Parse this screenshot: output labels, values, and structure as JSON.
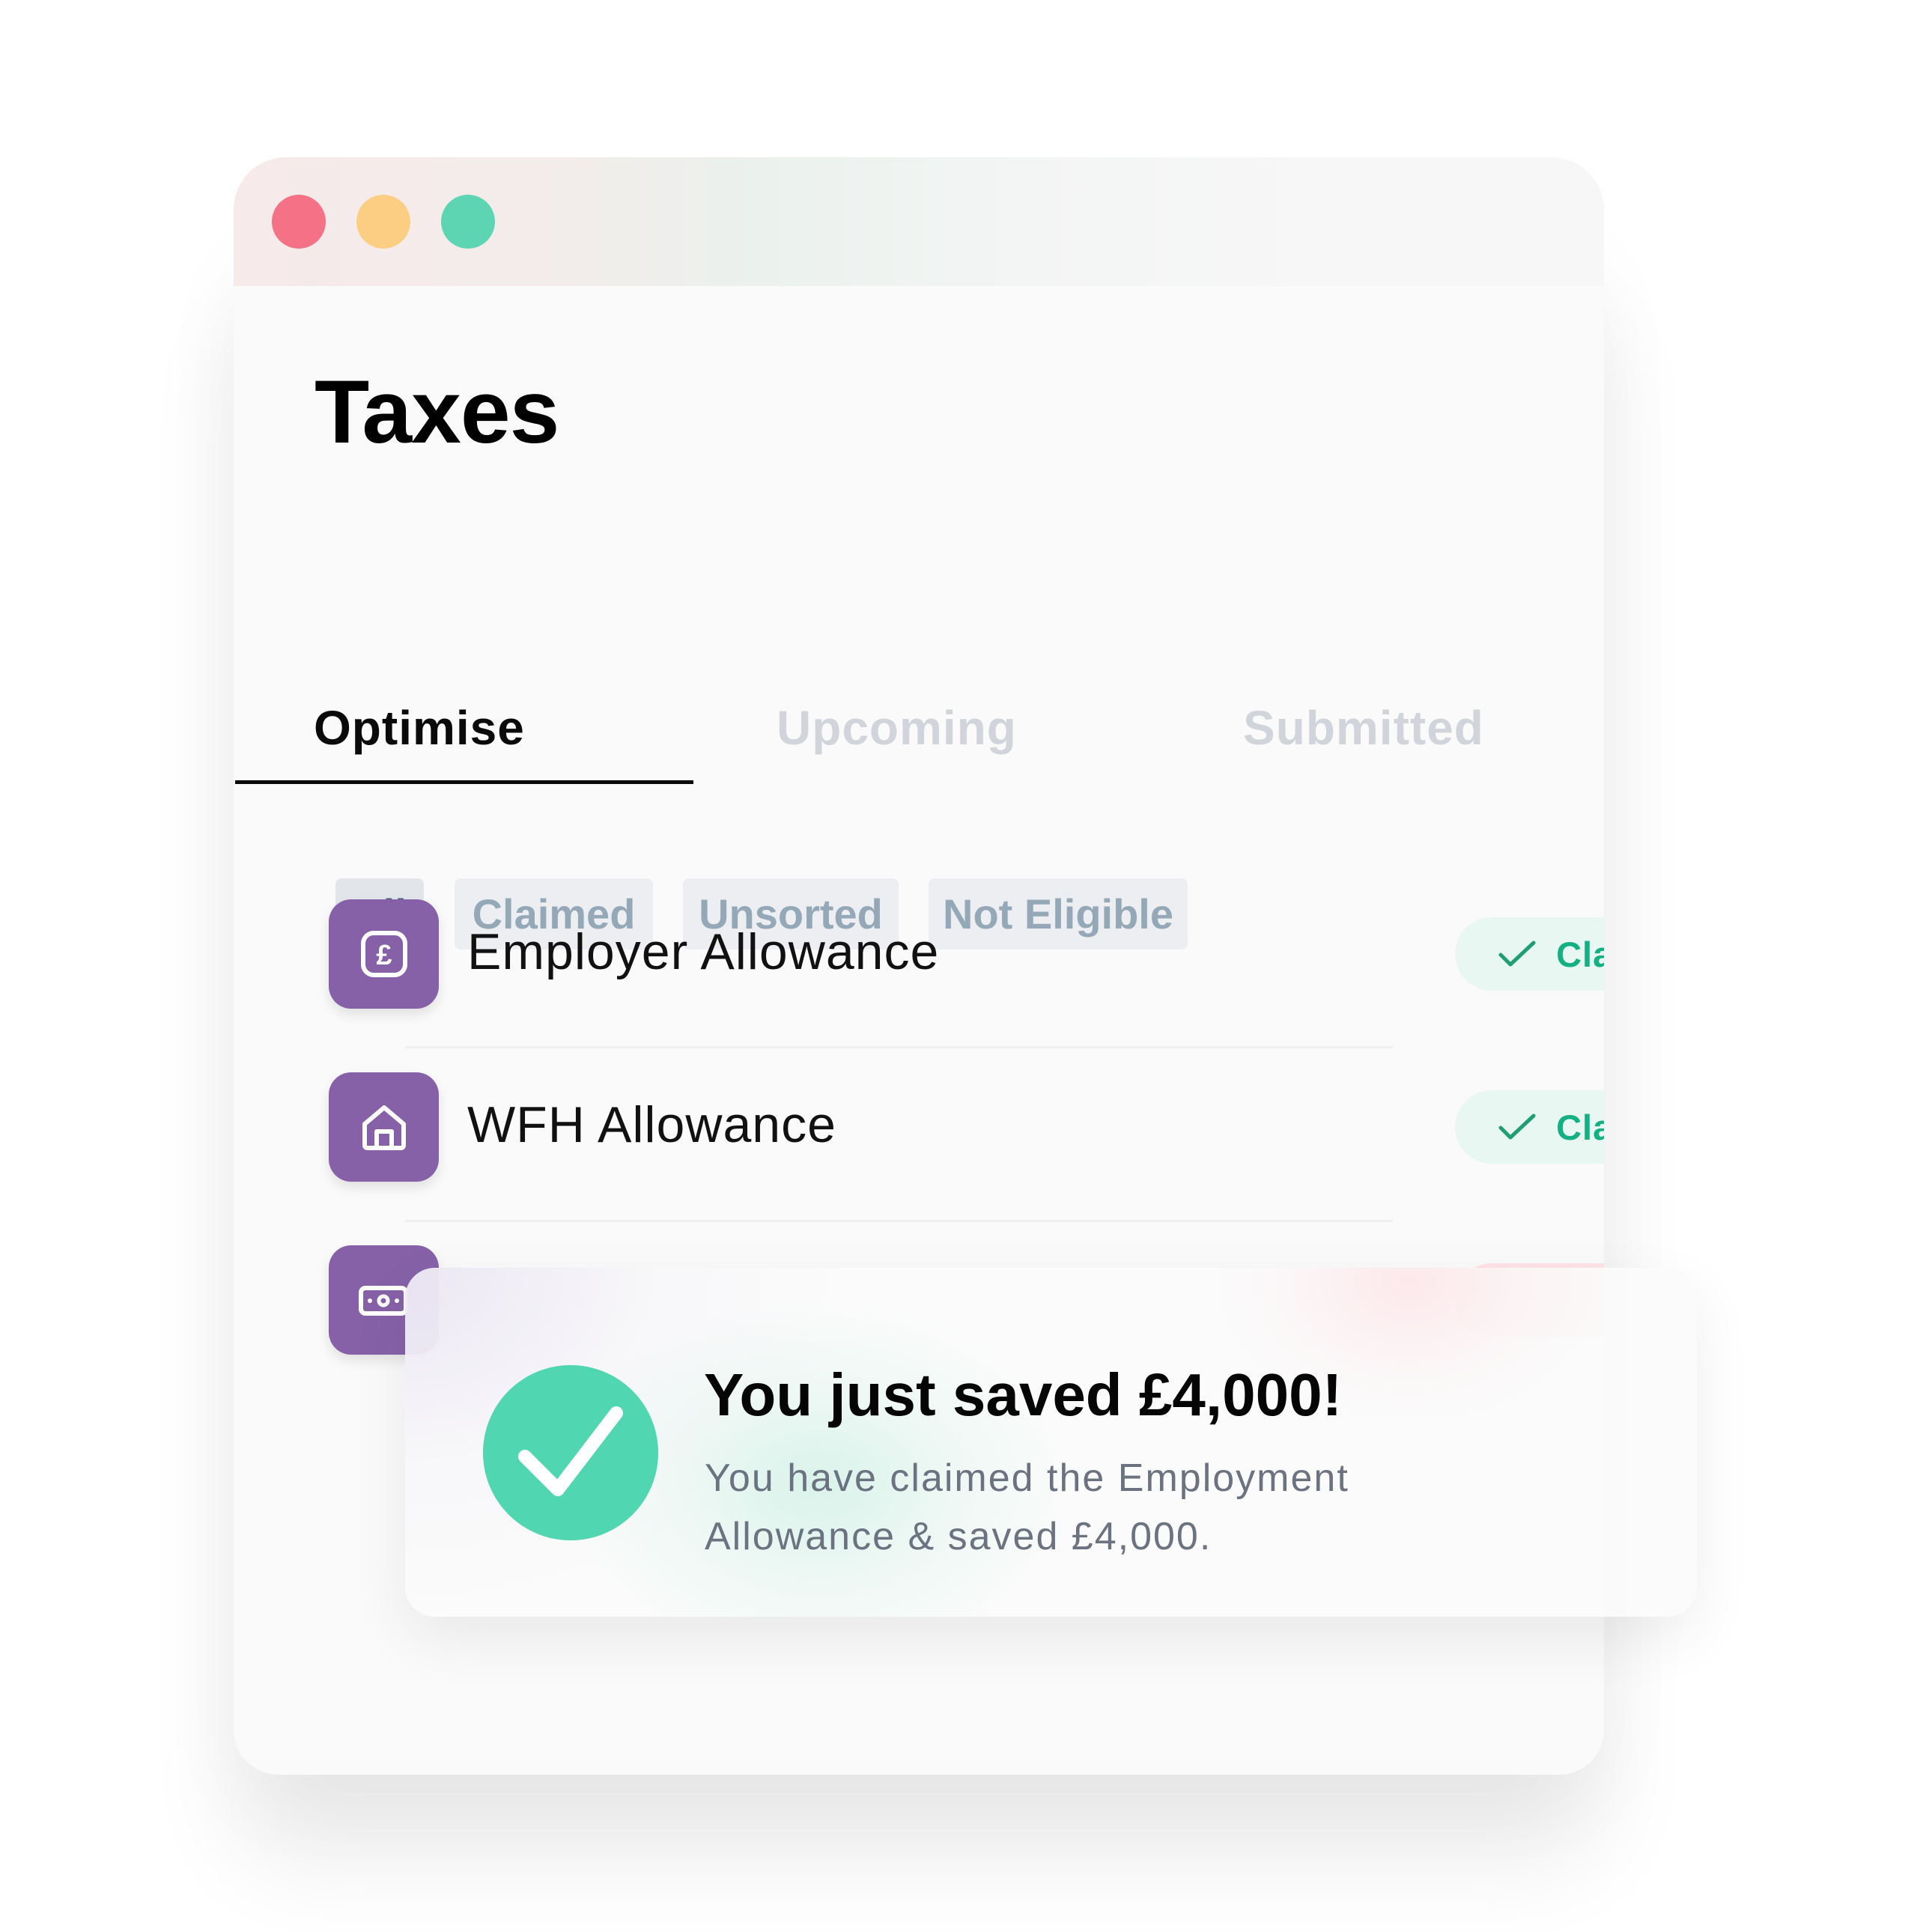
{
  "window": {
    "controls": [
      {
        "name": "close",
        "color": "#f57286"
      },
      {
        "name": "minimize",
        "color": "#fcce84"
      },
      {
        "name": "maximize",
        "color": "#5dd5b3"
      }
    ]
  },
  "header": {
    "title": "Taxes"
  },
  "tabs": [
    {
      "label": "Optimise",
      "active": true
    },
    {
      "label": "Upcoming",
      "active": false
    },
    {
      "label": "Submitted",
      "active": false
    }
  ],
  "filters": [
    {
      "label": "All",
      "active": true
    },
    {
      "label": "Claimed",
      "active": false
    },
    {
      "label": "Unsorted",
      "active": false
    },
    {
      "label": "Not Eligible",
      "active": false
    }
  ],
  "allowances": [
    {
      "label": "Employer Allowance",
      "icon": "pound-icon",
      "status": "Claimed",
      "status_icon": "check-icon"
    },
    {
      "label": "WFH Allowance",
      "icon": "home-icon",
      "status": "Claimed",
      "status_icon": "check-icon"
    },
    {
      "label": "",
      "icon": "banknote-icon",
      "status": ""
    }
  ],
  "toast": {
    "icon": "check-circle-icon",
    "title": "You just saved £4,000!",
    "message": "You have claimed the Employment Allowance & saved £4,000."
  },
  "colors": {
    "accent_purple": "#8661a8",
    "claimed_green": "#12b082",
    "claimed_bg": "#e8f7f2",
    "success_circle": "#50d6b0",
    "filter_active_text": "#3e5f7d",
    "filter_inactive_text": "#94a8b8",
    "tab_inactive": "#d1d5db"
  }
}
